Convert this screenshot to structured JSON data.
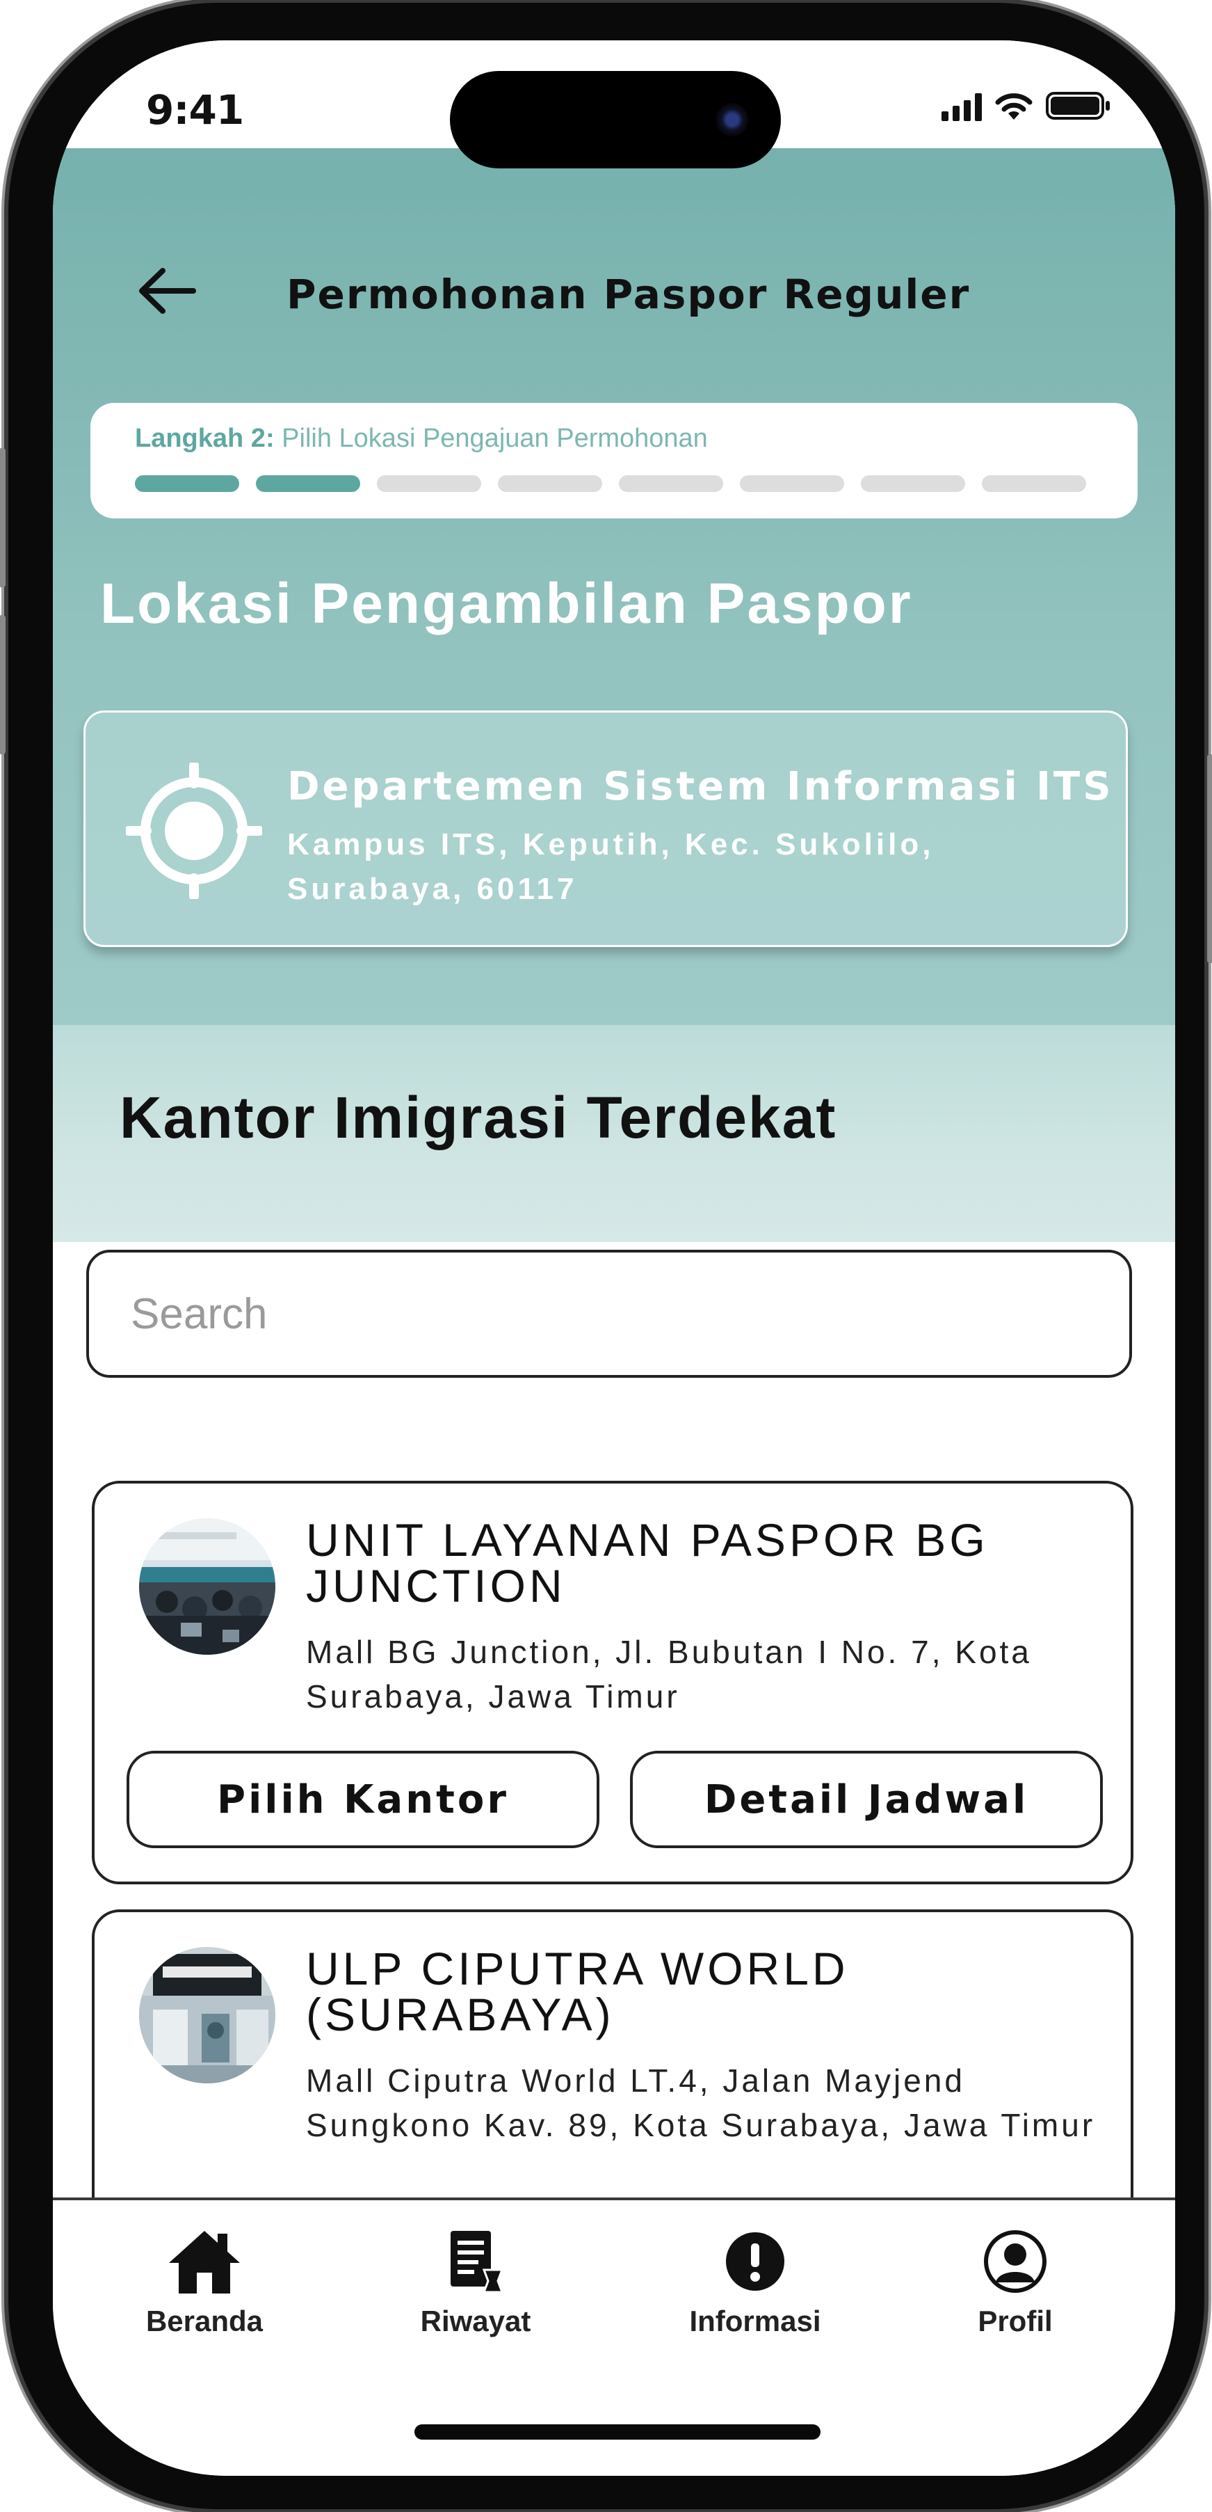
{
  "status_bar": {
    "time": "9:41"
  },
  "header": {
    "title": "Permohonan Paspor Reguler",
    "step_label_bold": "Langkah 2:",
    "step_label_text": "Pilih Lokasi Pengajuan Permohonan",
    "step_current": 2,
    "step_total": 8
  },
  "pickup": {
    "section_title": "Lokasi Pengambilan Paspor",
    "location_name": "Departemen Sistem Informasi ITS",
    "location_address": "Kampus ITS, Keputih, Kec. Sukolilo, Surabaya, 60117"
  },
  "offices_section": {
    "title": "Kantor Imigrasi Terdekat",
    "search_placeholder": "Search"
  },
  "offices": [
    {
      "name": "UNIT LAYANAN PASPOR BG JUNCTION",
      "address": "Mall BG Junction, Jl. Bubutan I No. 7, Kota Surabaya, Jawa Timur",
      "choose_label": "Pilih Kantor",
      "schedule_label": "Detail Jadwal"
    },
    {
      "name": "ULP CIPUTRA WORLD (SURABAYA)",
      "address": "Mall Ciputra World LT.4, Jalan Mayjend Sungkono Kav. 89, Kota Surabaya, Jawa Timur"
    }
  ],
  "bottom_nav": [
    {
      "label": "Beranda",
      "icon": "home-icon"
    },
    {
      "label": "Riwayat",
      "icon": "history-document-icon"
    },
    {
      "label": "Informasi",
      "icon": "info-alert-icon"
    },
    {
      "label": "Profil",
      "icon": "profile-icon"
    }
  ],
  "colors": {
    "teal_primary": "#5ea7a1",
    "teal_header": "#76b1ad",
    "teal_light": "#cfe5e3"
  }
}
